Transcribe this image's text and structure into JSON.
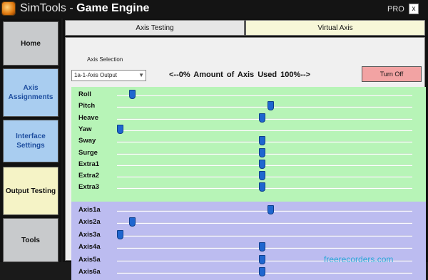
{
  "window": {
    "title_prefix": "SimTools - ",
    "title_bold": "Game Engine",
    "pro_label": "PRO",
    "close_glyph": "x"
  },
  "sidebar": {
    "items": [
      {
        "label": "Home",
        "color": "#c8cacc",
        "text_color": "#111111"
      },
      {
        "label": "Axis Assignments",
        "color": "#a9cdf0",
        "text_color": "#1f4fa0"
      },
      {
        "label": "Interface Settings",
        "color": "#a9cdf0",
        "text_color": "#1f4fa0"
      },
      {
        "label": "Output Testing",
        "color": "#f5f3c6",
        "text_color": "#111111"
      },
      {
        "label": "Tools",
        "color": "#c8cacc",
        "text_color": "#111111"
      }
    ]
  },
  "tabs": [
    {
      "label": "Axis Testing",
      "active": true
    },
    {
      "label": "Virtual Axis",
      "active": false
    }
  ],
  "toolbar": {
    "axis_selection_label": "Axis Selection",
    "axis_selection_value": "1a-1-Axis Output",
    "percent_header": "<--0%      Amount of Axis Used      100%-->",
    "turn_off_label": "Turn Off"
  },
  "colors": {
    "green_group": "#b7f4b7",
    "purple_group": "#bcbcf0",
    "thumb": "#1f66cf",
    "turn_off_bg": "#f2a3a3"
  },
  "dof_axes": [
    {
      "label": "Roll",
      "percent": 5
    },
    {
      "label": "Pitch",
      "percent": 52
    },
    {
      "label": "Heave",
      "percent": 49
    },
    {
      "label": "Yaw",
      "percent": 1
    },
    {
      "label": "Sway",
      "percent": 49
    },
    {
      "label": "Surge",
      "percent": 49
    },
    {
      "label": "Extra1",
      "percent": 49
    },
    {
      "label": "Extra2",
      "percent": 49
    },
    {
      "label": "Extra3",
      "percent": 49
    }
  ],
  "output_axes": [
    {
      "label": "Axis1a",
      "percent": 52
    },
    {
      "label": "Axis2a",
      "percent": 5
    },
    {
      "label": "Axis3a",
      "percent": 1
    },
    {
      "label": "Axis4a",
      "percent": 49
    },
    {
      "label": "Axis5a",
      "percent": 49
    },
    {
      "label": "Axis6a",
      "percent": 49
    }
  ],
  "watermark": "freerecorders.com"
}
